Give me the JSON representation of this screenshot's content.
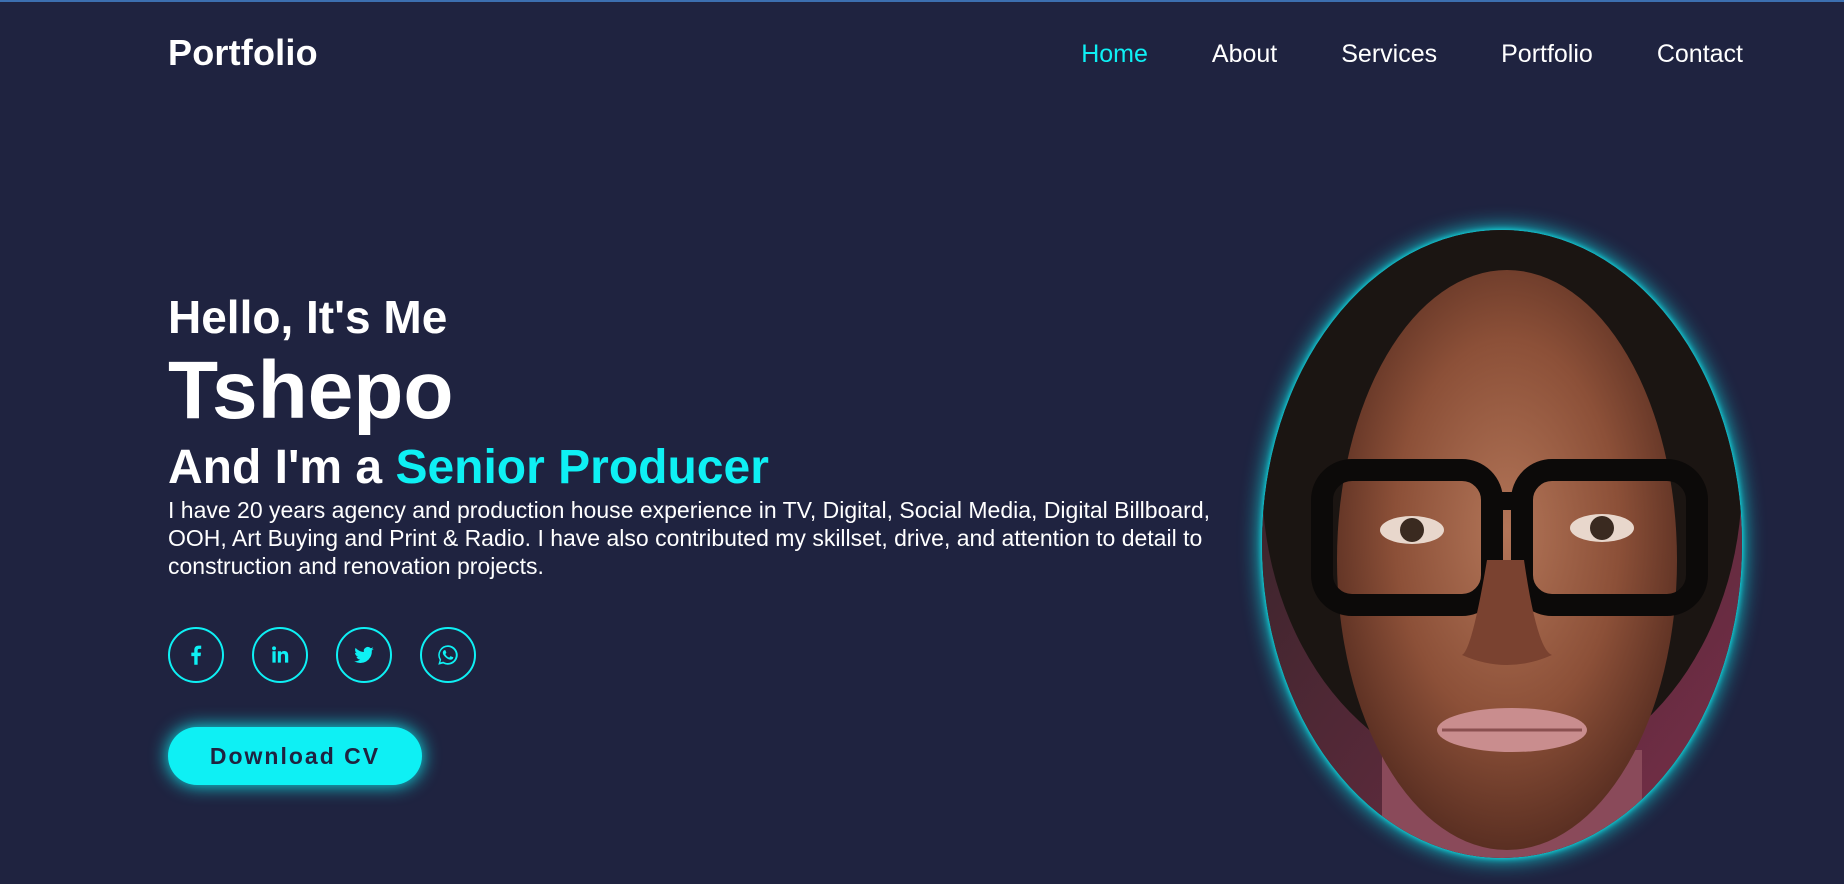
{
  "header": {
    "logo": "Portfolio",
    "nav": [
      {
        "label": "Home",
        "active": true
      },
      {
        "label": "About",
        "active": false
      },
      {
        "label": "Services",
        "active": false
      },
      {
        "label": "Portfolio",
        "active": false
      },
      {
        "label": "Contact",
        "active": false
      }
    ]
  },
  "hero": {
    "greeting": "Hello, It's Me",
    "name": "Tshepo",
    "role_prefix": "And I'm a ",
    "role": "Senior Producer",
    "description": "I have 20 years agency and production house experience in TV, Digital, Social Media, Digital Billboard, OOH, Art Buying and Print & Radio. I have also contributed my skillset, drive, and attention to detail to construction and renovation projects.",
    "socials": [
      {
        "icon": "facebook-icon"
      },
      {
        "icon": "linkedin-icon"
      },
      {
        "icon": "twitter-icon"
      },
      {
        "icon": "whatsapp-icon"
      }
    ],
    "cta": "Download CV"
  },
  "colors": {
    "background": "#1f2340",
    "accent": "#0ef0f4",
    "text": "#ffffff"
  }
}
